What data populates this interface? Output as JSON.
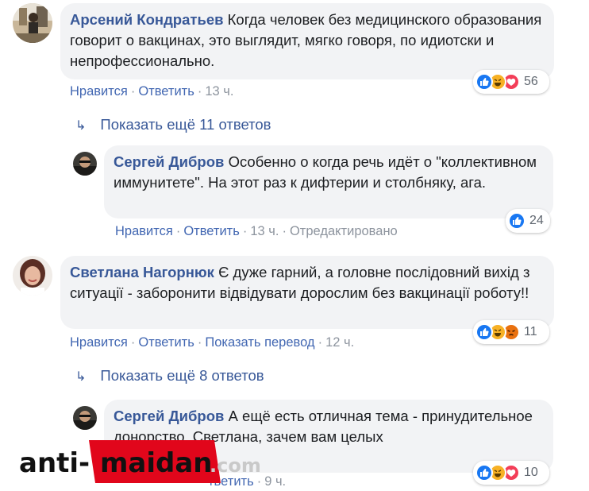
{
  "comments": [
    {
      "author": "Арсений Кондратьев",
      "text": "Когда человек без медицинского образования говорит о вакцинах, это выглядит, мягко говоря, по идиотски и непрофессионально.",
      "like": "Нравится",
      "reply": "Ответить",
      "time": "13 ч.",
      "reaction_count": "56",
      "reactions": [
        "like-icon",
        "haha-icon",
        "love-icon"
      ]
    },
    {
      "author": "Сергей Дибров",
      "text": "Особенно о когда речь идёт о \"коллективном иммунитете\". На этот раз к дифтерии и столбняку, ага.",
      "like": "Нравится",
      "reply": "Ответить",
      "time": "13 ч.",
      "edited": "Отредактировано",
      "reaction_count": "24",
      "reactions": [
        "like-icon"
      ]
    },
    {
      "author": "Светлана Нагорнюк",
      "text": "Є дуже гарний, а головне послідовний вихід з ситуації - заборонити відвідувати дорослим без вакцинації роботу!!",
      "like": "Нравится",
      "reply": "Ответить",
      "translate": "Показать перевод",
      "time": "12 ч.",
      "reaction_count": "11",
      "reactions": [
        "like-icon",
        "haha-icon",
        "angry-icon"
      ]
    },
    {
      "author": "Сергей Дибров",
      "text": "А ещё есть отличная тема - принудительное донорство. Светлана, зачем вам целых",
      "reply": "тветить",
      "time": "9 ч.",
      "reaction_count": "10",
      "reactions": [
        "like-icon",
        "haha-icon",
        "love-icon"
      ]
    }
  ],
  "more_replies": [
    {
      "label": "Показать ещё 11 ответов"
    },
    {
      "label": "Показать ещё 8 ответов"
    }
  ],
  "watermark": {
    "text": "anti-maidan.com"
  },
  "colors": {
    "link": "#385898",
    "action": "#4267b2",
    "bubble": "#f2f3f5",
    "like": "#1877f2",
    "haha": "#f7b125",
    "love": "#f33e58",
    "angry": "#e9710f",
    "watermark_red": "#e1061b"
  }
}
